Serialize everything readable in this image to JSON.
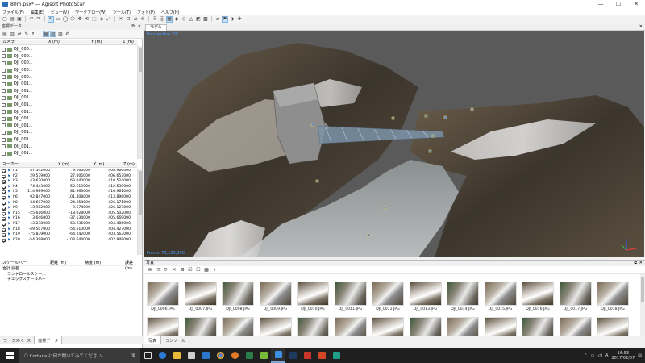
{
  "window": {
    "title": "80m.psx* — Agisoft PhotoScan",
    "minimize": "—",
    "maximize": "☐",
    "close": "✕"
  },
  "menu": [
    "ファイル(F)",
    "編集(E)",
    "ビュー(V)",
    "ワークフロー(W)",
    "ツール(T)",
    "フォト(P)",
    "ヘルプ(H)"
  ],
  "reference_panel": {
    "title": "座標データ",
    "camera_header": {
      "label": "カメラ",
      "x": "X (m)",
      "y": "Y (m)",
      "z": "Z (m)"
    },
    "cameras": [
      "DJI_000...",
      "DJI_000...",
      "DJI_000...",
      "DJI_000...",
      "DJI_000...",
      "DJI_001...",
      "DJI_001...",
      "DJI_001...",
      "DJI_001...",
      "DJI_001...",
      "DJI_001...",
      "DJI_001...",
      "DJI_001...",
      "DJI_001...",
      "DJI_001...",
      "DJI_001..."
    ],
    "marker_header": {
      "label": "マーカー",
      "x": "X (m)",
      "y": "Y (m)",
      "z": "Z (m)"
    },
    "markers": [
      {
        "name": "h1",
        "x": "47.542000",
        "y": "9.266000",
        "z": "408.966000"
      },
      {
        "name": "h2",
        "x": "29.579000",
        "y": "27.005000",
        "z": "406.653000"
      },
      {
        "name": "h3",
        "x": "43.620000",
        "y": "63.040000",
        "z": "410.524000"
      },
      {
        "name": "h4",
        "x": "74.443000",
        "y": "52.619000",
        "z": "412.539000"
      },
      {
        "name": "h5",
        "x": "114.989000",
        "y": "81.963000",
        "z": "416.961000"
      },
      {
        "name": "h6",
        "x": "92.847000",
        "y": "101.408000",
        "z": "413.896000"
      },
      {
        "name": "h8",
        "x": "34.697000",
        "y": "-24.254000",
        "z": "426.171000"
      },
      {
        "name": "h9",
        "x": "-13.902000",
        "y": "9.674000",
        "z": "426.127000"
      },
      {
        "name": "h15",
        "x": "-25.616000",
        "y": "-18.028000",
        "z": "405.502000"
      },
      {
        "name": "h16",
        "x": "3.646000",
        "y": "-37.134000",
        "z": "405.669000"
      },
      {
        "name": "h17",
        "x": "-13.238000",
        "y": "-63.236000",
        "z": "404.486000"
      },
      {
        "name": "h18",
        "x": "-49.507000",
        "y": "-54.610000",
        "z": "404.427000"
      },
      {
        "name": "h19",
        "x": "-75.839000",
        "y": "-64.242000",
        "z": "403.563000"
      },
      {
        "name": "h20",
        "x": "-54.398000",
        "y": "-103.644000",
        "z": "402.948000"
      }
    ],
    "scalebar_header": {
      "label": "スケールバー",
      "distance": "距離 (m)",
      "accuracy": "精度 (m)",
      "error": "誤差(m)"
    },
    "scalebar_rows": [
      "合計 誤差",
      "コントロールスケー...",
      "チェックスケールバー"
    ]
  },
  "left_tabs": [
    "ワークスペース",
    "座標データ"
  ],
  "model": {
    "tab": "モデル",
    "perspective": "Perspective 30°",
    "points_label": "Points: 73,115,390"
  },
  "photos": {
    "title": "写真",
    "items": [
      "DJI_0006.JPG",
      "DJI_0007.JPG",
      "DJI_0008.JPG",
      "DJI_0009.JPG",
      "DJI_0010.JPG",
      "DJI_0011.JPG",
      "DJI_0012.JPG",
      "DJI_0013.JPG",
      "DJI_0014.JPG",
      "DJI_0015.JPG",
      "DJI_0016.JPG",
      "DJI_0017.JPG",
      "DJI_0018.JPG"
    ]
  },
  "bottom_tabs": [
    "写真",
    "コンソール"
  ],
  "taskbar": {
    "search_placeholder": "Cortana に何か聞いてみてください。",
    "time": "16:53",
    "date": "2017/02/07"
  }
}
